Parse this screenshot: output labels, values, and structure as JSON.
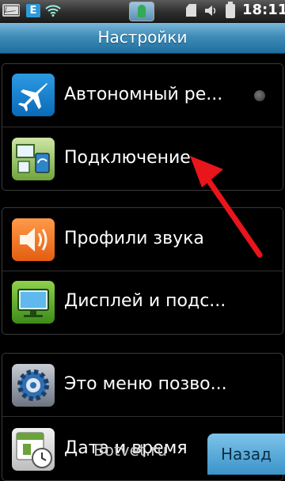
{
  "status_bar": {
    "icons": [
      "mail-icon",
      "e-network-icon",
      "wifi-icon",
      "app-notification-icon",
      "sd-card-icon",
      "volume-icon",
      "battery-icon"
    ],
    "time": "18:11"
  },
  "header": {
    "title": "Настройки"
  },
  "settings": {
    "items": [
      {
        "label": "Автономный ре...",
        "icon": "airplane-icon"
      },
      {
        "label": "Подключение",
        "icon": "connection-icon"
      },
      {
        "label": "Профили звука",
        "icon": "sound-icon"
      },
      {
        "label": "Дисплей и подс...",
        "icon": "display-icon"
      },
      {
        "label": "Это меню позво...",
        "icon": "gear-icon"
      },
      {
        "label": "Дата и время",
        "icon": "calendar-clock-icon"
      }
    ]
  },
  "footer": {
    "back_label": "Назад",
    "watermark": "Botvet.ru"
  },
  "colors": {
    "title_bar": "#3f8bb7",
    "back_button": "#5aaad8",
    "arrow": "#e8151b"
  }
}
